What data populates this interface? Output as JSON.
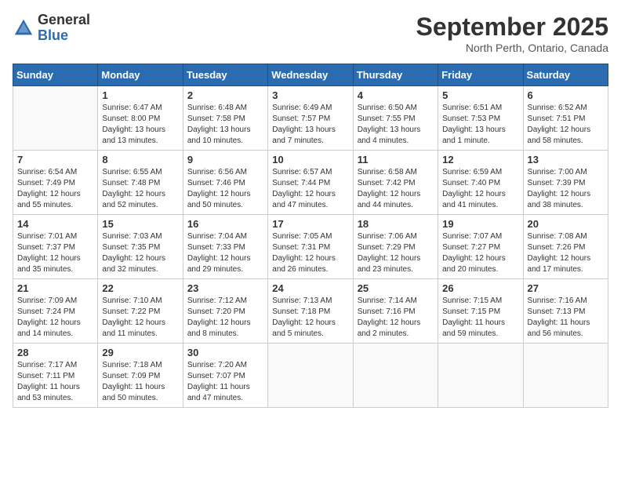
{
  "header": {
    "logo_general": "General",
    "logo_blue": "Blue",
    "month_title": "September 2025",
    "location": "North Perth, Ontario, Canada"
  },
  "days_of_week": [
    "Sunday",
    "Monday",
    "Tuesday",
    "Wednesday",
    "Thursday",
    "Friday",
    "Saturday"
  ],
  "weeks": [
    [
      {
        "day": "",
        "info": ""
      },
      {
        "day": "1",
        "info": "Sunrise: 6:47 AM\nSunset: 8:00 PM\nDaylight: 13 hours\nand 13 minutes."
      },
      {
        "day": "2",
        "info": "Sunrise: 6:48 AM\nSunset: 7:58 PM\nDaylight: 13 hours\nand 10 minutes."
      },
      {
        "day": "3",
        "info": "Sunrise: 6:49 AM\nSunset: 7:57 PM\nDaylight: 13 hours\nand 7 minutes."
      },
      {
        "day": "4",
        "info": "Sunrise: 6:50 AM\nSunset: 7:55 PM\nDaylight: 13 hours\nand 4 minutes."
      },
      {
        "day": "5",
        "info": "Sunrise: 6:51 AM\nSunset: 7:53 PM\nDaylight: 13 hours\nand 1 minute."
      },
      {
        "day": "6",
        "info": "Sunrise: 6:52 AM\nSunset: 7:51 PM\nDaylight: 12 hours\nand 58 minutes."
      }
    ],
    [
      {
        "day": "7",
        "info": "Sunrise: 6:54 AM\nSunset: 7:49 PM\nDaylight: 12 hours\nand 55 minutes."
      },
      {
        "day": "8",
        "info": "Sunrise: 6:55 AM\nSunset: 7:48 PM\nDaylight: 12 hours\nand 52 minutes."
      },
      {
        "day": "9",
        "info": "Sunrise: 6:56 AM\nSunset: 7:46 PM\nDaylight: 12 hours\nand 50 minutes."
      },
      {
        "day": "10",
        "info": "Sunrise: 6:57 AM\nSunset: 7:44 PM\nDaylight: 12 hours\nand 47 minutes."
      },
      {
        "day": "11",
        "info": "Sunrise: 6:58 AM\nSunset: 7:42 PM\nDaylight: 12 hours\nand 44 minutes."
      },
      {
        "day": "12",
        "info": "Sunrise: 6:59 AM\nSunset: 7:40 PM\nDaylight: 12 hours\nand 41 minutes."
      },
      {
        "day": "13",
        "info": "Sunrise: 7:00 AM\nSunset: 7:39 PM\nDaylight: 12 hours\nand 38 minutes."
      }
    ],
    [
      {
        "day": "14",
        "info": "Sunrise: 7:01 AM\nSunset: 7:37 PM\nDaylight: 12 hours\nand 35 minutes."
      },
      {
        "day": "15",
        "info": "Sunrise: 7:03 AM\nSunset: 7:35 PM\nDaylight: 12 hours\nand 32 minutes."
      },
      {
        "day": "16",
        "info": "Sunrise: 7:04 AM\nSunset: 7:33 PM\nDaylight: 12 hours\nand 29 minutes."
      },
      {
        "day": "17",
        "info": "Sunrise: 7:05 AM\nSunset: 7:31 PM\nDaylight: 12 hours\nand 26 minutes."
      },
      {
        "day": "18",
        "info": "Sunrise: 7:06 AM\nSunset: 7:29 PM\nDaylight: 12 hours\nand 23 minutes."
      },
      {
        "day": "19",
        "info": "Sunrise: 7:07 AM\nSunset: 7:27 PM\nDaylight: 12 hours\nand 20 minutes."
      },
      {
        "day": "20",
        "info": "Sunrise: 7:08 AM\nSunset: 7:26 PM\nDaylight: 12 hours\nand 17 minutes."
      }
    ],
    [
      {
        "day": "21",
        "info": "Sunrise: 7:09 AM\nSunset: 7:24 PM\nDaylight: 12 hours\nand 14 minutes."
      },
      {
        "day": "22",
        "info": "Sunrise: 7:10 AM\nSunset: 7:22 PM\nDaylight: 12 hours\nand 11 minutes."
      },
      {
        "day": "23",
        "info": "Sunrise: 7:12 AM\nSunset: 7:20 PM\nDaylight: 12 hours\nand 8 minutes."
      },
      {
        "day": "24",
        "info": "Sunrise: 7:13 AM\nSunset: 7:18 PM\nDaylight: 12 hours\nand 5 minutes."
      },
      {
        "day": "25",
        "info": "Sunrise: 7:14 AM\nSunset: 7:16 PM\nDaylight: 12 hours\nand 2 minutes."
      },
      {
        "day": "26",
        "info": "Sunrise: 7:15 AM\nSunset: 7:15 PM\nDaylight: 11 hours\nand 59 minutes."
      },
      {
        "day": "27",
        "info": "Sunrise: 7:16 AM\nSunset: 7:13 PM\nDaylight: 11 hours\nand 56 minutes."
      }
    ],
    [
      {
        "day": "28",
        "info": "Sunrise: 7:17 AM\nSunset: 7:11 PM\nDaylight: 11 hours\nand 53 minutes."
      },
      {
        "day": "29",
        "info": "Sunrise: 7:18 AM\nSunset: 7:09 PM\nDaylight: 11 hours\nand 50 minutes."
      },
      {
        "day": "30",
        "info": "Sunrise: 7:20 AM\nSunset: 7:07 PM\nDaylight: 11 hours\nand 47 minutes."
      },
      {
        "day": "",
        "info": ""
      },
      {
        "day": "",
        "info": ""
      },
      {
        "day": "",
        "info": ""
      },
      {
        "day": "",
        "info": ""
      }
    ]
  ]
}
